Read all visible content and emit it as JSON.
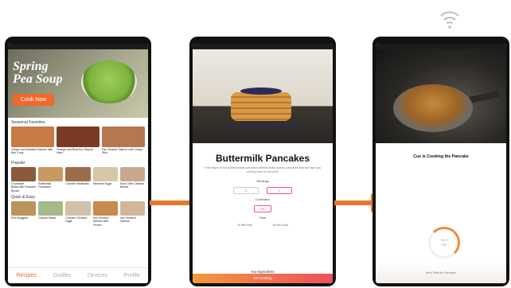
{
  "screen1": {
    "hero_title": "Spring Pea Soup",
    "cook_now": "Cook Now",
    "sections": {
      "seasonal": "Seasonal Favorites",
      "popular": "Popular",
      "quick": "Quick & Easy"
    },
    "seasonal_cards": [
      {
        "caption": "Ginger and Mustard Salmon with Bok Choy",
        "color": "#c87a43"
      },
      {
        "caption": "Orange and Bourbon Glazed Ham",
        "color": "#7a3b25"
      },
      {
        "caption": "Pan-Seared Salmon with Crispy Skin",
        "color": "#b57652"
      }
    ],
    "popular_cards": [
      {
        "caption": "Chocolate Buttermilk Pumpkin Bread",
        "color": "#8a5a3a"
      },
      {
        "caption": "Buttermilk Pancakes",
        "color": "#c89a62"
      },
      {
        "caption": "Chicken Meatballs",
        "color": "#9f6c4a"
      },
      {
        "caption": "Steamed Eggs",
        "color": "#d8c7a5"
      },
      {
        "caption": "Sous Vide Chicken Breast",
        "color": "#c9a98e"
      }
    ],
    "quick_cards": [
      {
        "caption": "Fish Nuggets",
        "color": "#b9955a"
      },
      {
        "caption": "Caesar Salad",
        "color": "#a7b98a"
      },
      {
        "caption": "Chicken-Crusted Eggs",
        "color": "#cfc2a9"
      },
      {
        "caption": "Hot Smoked Salmon with Fennel",
        "color": "#c9884c"
      },
      {
        "caption": "Hot Smoked Salmon",
        "color": "#d3b59a"
      }
    ],
    "nav": [
      "Recipes",
      "Guides",
      "Devices",
      "Profile"
    ]
  },
  "screen2": {
    "title": "Buttermilk Pancakes",
    "description": "This recipe of the quintessential pancakes delivers fluffy, buttery pancakes that will have you coming back for seconds.",
    "servings_label": "Servings",
    "servings": [
      "1",
      "2"
    ],
    "cookware_label": "Cookware",
    "cookware": "Pan",
    "time_label": "Time",
    "prep": "10 min Prep",
    "cook": "40 min Cook",
    "ingredients": "Key Ingredients",
    "cta": "Get Cooking"
  },
  "screen3": {
    "cue_text": "Cue is Cooking the Pancake",
    "ring_top": "Flip It",
    "ring_bottom": "0:00",
    "below": "Next: Plate the Pancakes"
  }
}
